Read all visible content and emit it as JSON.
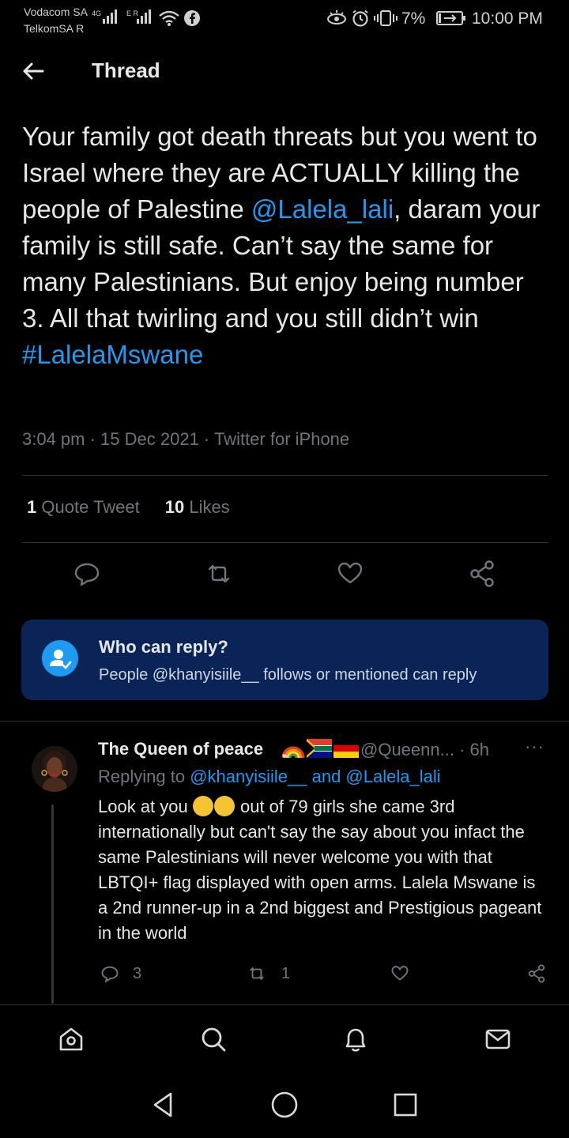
{
  "status_bar": {
    "carrier1": "Vodacom SA",
    "carrier2": "TelkomSA R",
    "net1": "4G",
    "net2": "E R",
    "battery": "7%",
    "time": "10:00 PM"
  },
  "header": {
    "title": "Thread",
    "back_icon": "arrow-left-icon"
  },
  "tweet": {
    "text_parts": [
      "Your family got death threats but you went to Israel where they are ACTUALLY killing the people of Palestine ",
      "@Lalela_lali",
      ", daram your family is still safe. Can’t say the same for many Palestinians. But enjoy being number 3. All that twirling and you still didn’t win ",
      "#LalelaMswane"
    ],
    "meta": "3:04 pm · 15 Dec 2021 · Twitter for iPhone",
    "quote_count": "1",
    "quote_label": "Quote Tweet",
    "likes_count": "10",
    "likes_label": "Likes",
    "accent_color": "#1d9bf0"
  },
  "who_can_reply": {
    "title": "Who can reply?",
    "description": "People @khanyisiile__ follows or mentioned can reply",
    "bg_color": "#0a2457"
  },
  "reply": {
    "name": "The Queen of peace",
    "handle": "@Queenn...",
    "time": "· 6h",
    "more": "···",
    "replying_prefix": "Replying to ",
    "replying_user1": "@khanyisiile__",
    "replying_and": " and ",
    "replying_user2": "@Lalela_lali",
    "text_start": "Look at you ",
    "text_rest": " out of 79 girls she came 3rd internationally but can't say the say about you infact the same Palestinians will never welcome you with that LBTQI+ flag displayed with open arms. Lalela Mswane is a 2nd runner-up in a 2nd biggest and Prestigious pageant in the world",
    "reply_count": "3",
    "retweet_count": "1"
  },
  "bottom_nav": [
    "home-icon",
    "search-icon",
    "notifications-icon",
    "messages-icon"
  ],
  "system_nav": [
    "back-triangle-icon",
    "home-circle-icon",
    "recents-square-icon"
  ]
}
